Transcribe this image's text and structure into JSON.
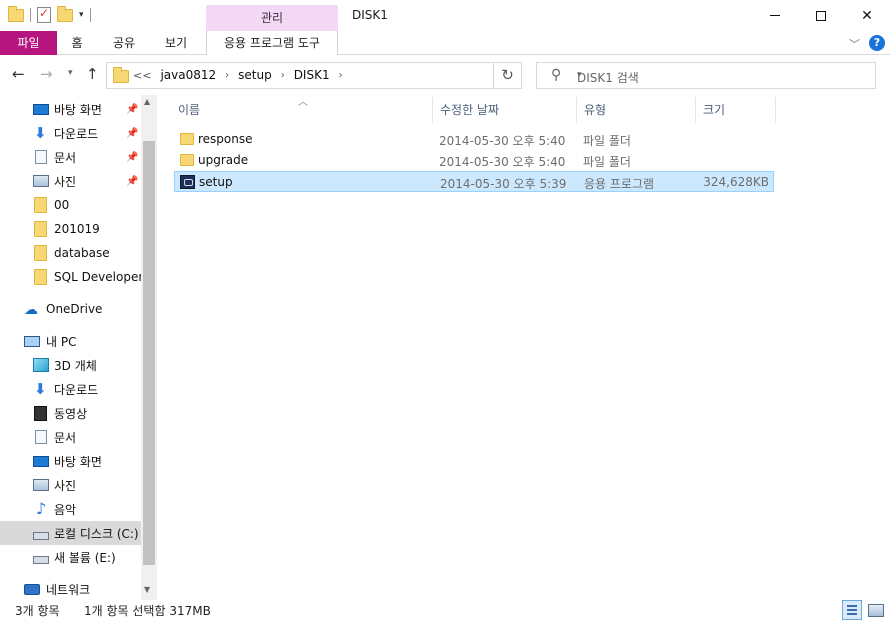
{
  "window": {
    "title": "DISK1",
    "manage_tab": "관리",
    "minimize_label": "—",
    "maximize_label": "",
    "close_label": "✕"
  },
  "ribbon": {
    "tabs": [
      "파일",
      "홈",
      "공유",
      "보기",
      "응용 프로그램 도구"
    ],
    "help_label": "?"
  },
  "address": {
    "overflow": "<<",
    "crumbs": [
      "java0812",
      "setup",
      "DISK1"
    ],
    "search_placeholder": "DISK1 검색"
  },
  "sidebar": {
    "quick_access": [
      {
        "label": "바탕 화면",
        "icon": "desktop-icon",
        "pinned": true
      },
      {
        "label": "다운로드",
        "icon": "download-icon",
        "pinned": true
      },
      {
        "label": "문서",
        "icon": "documents-icon",
        "pinned": true
      },
      {
        "label": "사진",
        "icon": "pictures-icon",
        "pinned": true
      },
      {
        "label": "00",
        "icon": "folder-icon",
        "pinned": false
      },
      {
        "label": "201019",
        "icon": "folder-icon",
        "pinned": false
      },
      {
        "label": "database",
        "icon": "folder-icon",
        "pinned": false
      },
      {
        "label": "SQL Developer",
        "icon": "folder-icon",
        "pinned": false
      }
    ],
    "onedrive": "OneDrive",
    "this_pc": "내 PC",
    "pc_items": [
      {
        "label": "3D 개체",
        "icon": "3d-objects-icon"
      },
      {
        "label": "다운로드",
        "icon": "download-icon"
      },
      {
        "label": "동영상",
        "icon": "videos-icon"
      },
      {
        "label": "문서",
        "icon": "documents-icon"
      },
      {
        "label": "바탕 화면",
        "icon": "desktop-icon"
      },
      {
        "label": "사진",
        "icon": "pictures-icon"
      },
      {
        "label": "음악",
        "icon": "music-icon"
      },
      {
        "label": "로컬 디스크 (C:)",
        "icon": "local-disk-icon"
      },
      {
        "label": "새 볼륨 (E:)",
        "icon": "drive-icon"
      }
    ],
    "network": "네트워크"
  },
  "columns": {
    "name": "이름",
    "date": "수정한 날짜",
    "type": "유형",
    "size": "크기"
  },
  "files": [
    {
      "name": "response",
      "date": "2014-05-30 오후 5:40",
      "type": "파일 폴더",
      "size": "",
      "icon": "folder-icon",
      "selected": false
    },
    {
      "name": "upgrade",
      "date": "2014-05-30 오후 5:40",
      "type": "파일 폴더",
      "size": "",
      "icon": "folder-icon",
      "selected": false
    },
    {
      "name": "setup",
      "date": "2014-05-30 오후 5:39",
      "type": "응용 프로그램",
      "size": "324,628KB",
      "icon": "application-icon",
      "selected": true
    }
  ],
  "status": {
    "count": "3개 항목",
    "selection": "1개 항목 선택함 317MB"
  },
  "colors": {
    "file_tab": "#b6157f",
    "manage_tab": "#f3d9f6",
    "selection": "#cce8ff",
    "hover": "#d9d9d9"
  }
}
